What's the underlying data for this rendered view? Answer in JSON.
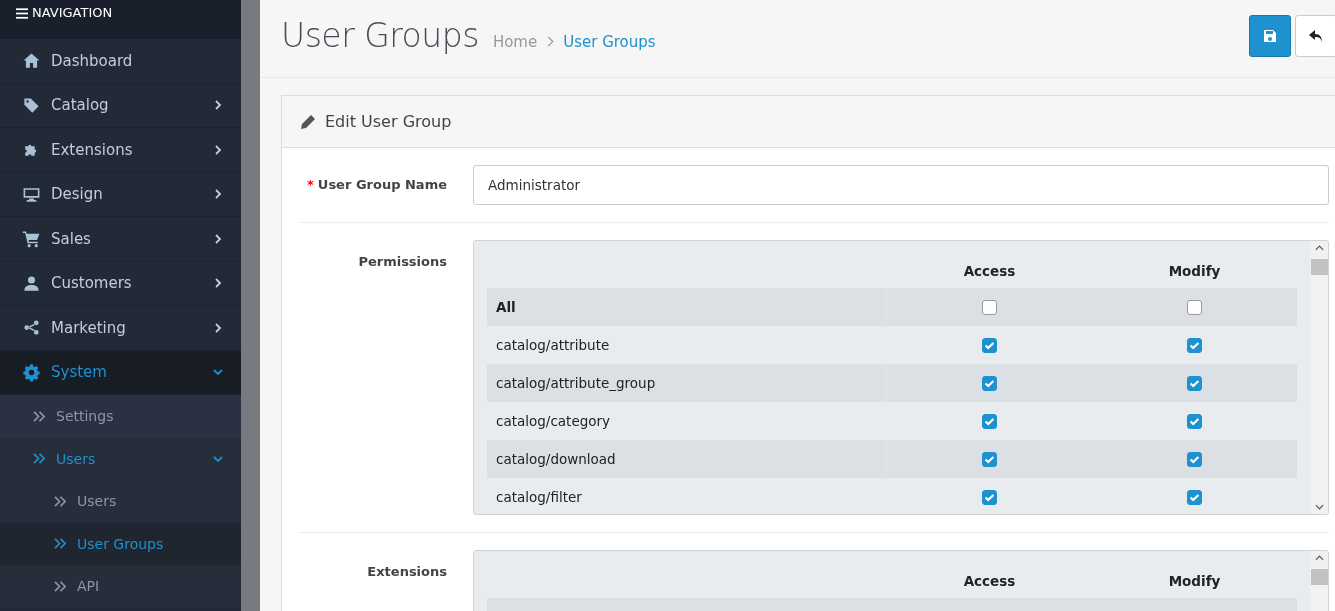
{
  "nav": {
    "title": "NAVIGATION",
    "items": [
      {
        "label": "Dashboard",
        "kind": "link",
        "selected": false
      },
      {
        "label": "Catalog",
        "kind": "menu",
        "selected": false,
        "expanded": false
      },
      {
        "label": "Extensions",
        "kind": "menu",
        "selected": false,
        "expanded": false
      },
      {
        "label": "Design",
        "kind": "menu",
        "selected": false,
        "expanded": false
      },
      {
        "label": "Sales",
        "kind": "menu",
        "selected": false,
        "expanded": false
      },
      {
        "label": "Customers",
        "kind": "menu",
        "selected": false,
        "expanded": false
      },
      {
        "label": "Marketing",
        "kind": "menu",
        "selected": false,
        "expanded": false
      },
      {
        "label": "System",
        "kind": "menu",
        "selected": true,
        "expanded": true,
        "children": [
          {
            "label": "Settings",
            "kind": "link",
            "selected": false
          },
          {
            "label": "Users",
            "kind": "menu",
            "selected": true,
            "expanded": true,
            "children": [
              {
                "label": "Users",
                "selected": false
              },
              {
                "label": "User Groups",
                "selected": true
              },
              {
                "label": "API",
                "selected": false
              }
            ]
          }
        ]
      }
    ]
  },
  "header": {
    "title": "User Groups",
    "breadcrumb": [
      {
        "label": "Home",
        "selected": false
      },
      {
        "label": "User Groups",
        "selected": true
      }
    ]
  },
  "panel": {
    "title": "Edit User Group",
    "name_field": {
      "label": "User Group Name",
      "required_mark": "*",
      "value": "Administrator"
    },
    "permission_tables": [
      {
        "label": "Permissions",
        "columns": [
          "Access",
          "Modify"
        ],
        "rows": [
          {
            "name": "All",
            "access": false,
            "modify": false
          },
          {
            "name": "catalog/attribute",
            "access": true,
            "modify": true
          },
          {
            "name": "catalog/attribute_group",
            "access": true,
            "modify": true
          },
          {
            "name": "catalog/category",
            "access": true,
            "modify": true
          },
          {
            "name": "catalog/download",
            "access": true,
            "modify": true
          },
          {
            "name": "catalog/filter",
            "access": true,
            "modify": true
          }
        ]
      },
      {
        "label": "Extensions",
        "columns": [
          "Access",
          "Modify"
        ]
      }
    ]
  }
}
